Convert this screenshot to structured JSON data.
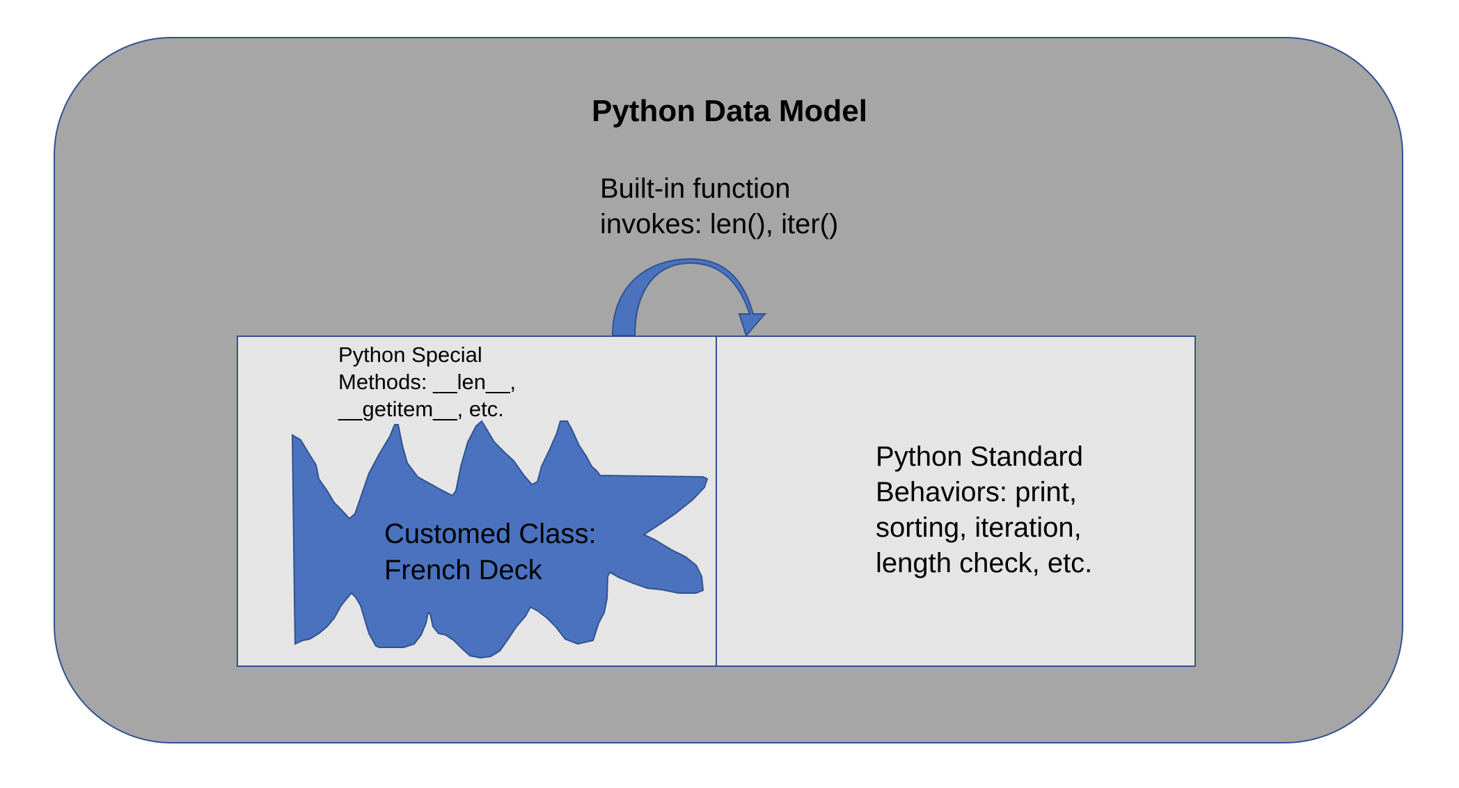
{
  "diagram": {
    "title": "Python Data Model",
    "arrow_label_line1": "Built-in function",
    "arrow_label_line2": "invokes: len(), iter()",
    "special_methods_line1": "Python Special",
    "special_methods_line2": "Methods: __len__,",
    "special_methods_line3": "__getitem__, etc.",
    "custom_class_line1": "Customed Class:",
    "custom_class_line2": "French Deck",
    "standard_line1": "Python Standard",
    "standard_line2": "Behaviors: print,",
    "standard_line3": "sorting, iteration,",
    "standard_line4": "length check, etc."
  },
  "colors": {
    "outer_fill": "#a6a6a6",
    "outline": "#2f528f",
    "box_fill": "#e5e5e5",
    "shape_fill": "#4a72bf",
    "arrow_fill": "#4a72bf"
  },
  "icons": {
    "arrow": "curved-arrow-icon",
    "shape": "wave-shape-icon"
  }
}
